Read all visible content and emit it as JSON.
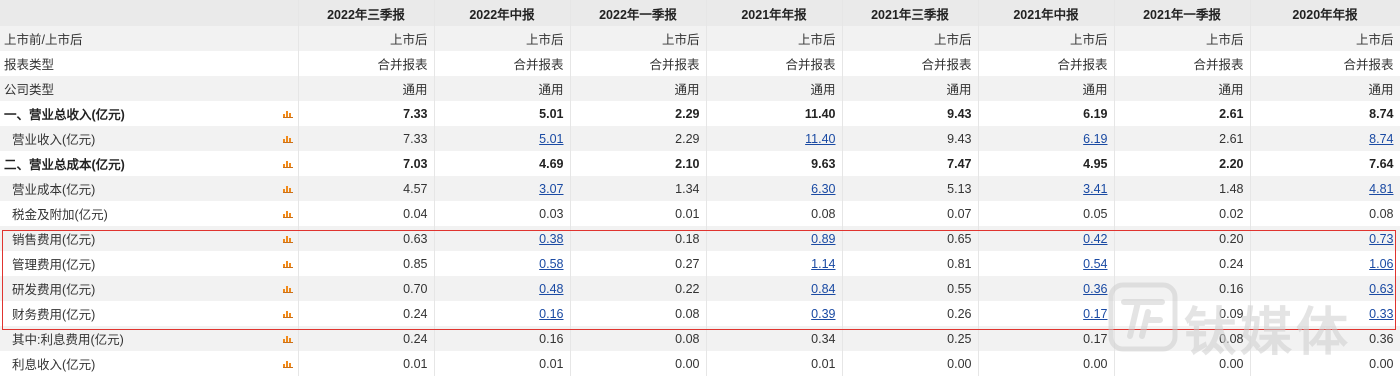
{
  "header": {
    "corner": "",
    "periods": [
      "2022年三季报",
      "2022年中报",
      "2022年一季报",
      "2021年年报",
      "2021年三季报",
      "2021年中报",
      "2021年一季报",
      "2020年年报"
    ]
  },
  "rows": [
    {
      "label": "上市前/上市后",
      "values": [
        "上市后",
        "上市后",
        "上市后",
        "上市后",
        "上市后",
        "上市后",
        "上市后",
        "上市后"
      ]
    },
    {
      "label": "报表类型",
      "values": [
        "合并报表",
        "合并报表",
        "合并报表",
        "合并报表",
        "合并报表",
        "合并报表",
        "合并报表",
        "合并报表"
      ]
    },
    {
      "label": "公司类型",
      "values": [
        "通用",
        "通用",
        "通用",
        "通用",
        "通用",
        "通用",
        "通用",
        "通用"
      ]
    },
    {
      "label": "一、营业总收入(亿元)",
      "values": [
        "7.33",
        "5.01",
        "2.29",
        "11.40",
        "9.43",
        "6.19",
        "2.61",
        "8.74"
      ]
    },
    {
      "label": "营业收入(亿元)",
      "values": [
        "7.33",
        "5.01",
        "2.29",
        "11.40",
        "9.43",
        "6.19",
        "2.61",
        "8.74"
      ]
    },
    {
      "label": "二、营业总成本(亿元)",
      "values": [
        "7.03",
        "4.69",
        "2.10",
        "9.63",
        "7.47",
        "4.95",
        "2.20",
        "7.64"
      ]
    },
    {
      "label": "营业成本(亿元)",
      "values": [
        "4.57",
        "3.07",
        "1.34",
        "6.30",
        "5.13",
        "3.41",
        "1.48",
        "4.81"
      ]
    },
    {
      "label": "税金及附加(亿元)",
      "values": [
        "0.04",
        "0.03",
        "0.01",
        "0.08",
        "0.07",
        "0.05",
        "0.02",
        "0.08"
      ]
    },
    {
      "label": "销售费用(亿元)",
      "values": [
        "0.63",
        "0.38",
        "0.18",
        "0.89",
        "0.65",
        "0.42",
        "0.20",
        "0.73"
      ]
    },
    {
      "label": "管理费用(亿元)",
      "values": [
        "0.85",
        "0.58",
        "0.27",
        "1.14",
        "0.81",
        "0.54",
        "0.24",
        "1.06"
      ]
    },
    {
      "label": "研发费用(亿元)",
      "values": [
        "0.70",
        "0.48",
        "0.22",
        "0.84",
        "0.55",
        "0.36",
        "0.16",
        "0.63"
      ]
    },
    {
      "label": "财务费用(亿元)",
      "values": [
        "0.24",
        "0.16",
        "0.08",
        "0.39",
        "0.26",
        "0.17",
        "0.09",
        "0.33"
      ]
    },
    {
      "label": "其中:利息费用(亿元)",
      "values": [
        "0.24",
        "0.16",
        "0.08",
        "0.34",
        "0.25",
        "0.17",
        "0.08",
        "0.36"
      ]
    },
    {
      "label": "利息收入(亿元)",
      "values": [
        "0.01",
        "0.01",
        "0.00",
        "0.01",
        "0.00",
        "0.00",
        "0.00",
        "0.00"
      ]
    }
  ],
  "watermark": {
    "text": "钛媒体"
  },
  "colors": {
    "link": "#1a4aa3",
    "highlight": "#e0342f",
    "header_bg": "#eaeaea",
    "icon": "#f08a1a"
  }
}
